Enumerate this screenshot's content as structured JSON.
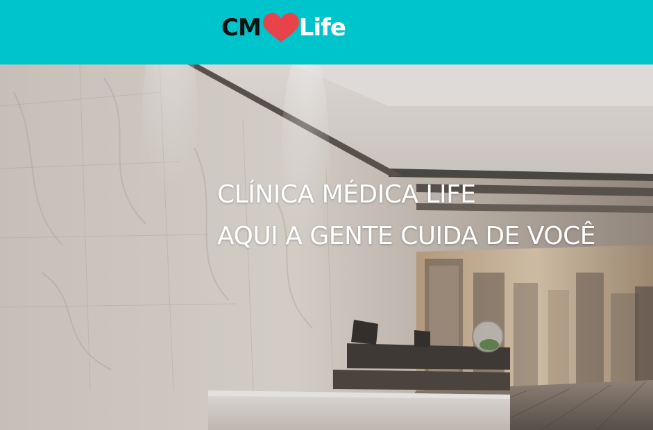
{
  "header": {
    "logo": {
      "prefix": "CM",
      "icon": "heart-icon",
      "suffix": "Life",
      "accent_color": "#e8434a"
    },
    "background_color": "#00c4cc"
  },
  "hero": {
    "line1": "CLÍNICA MÉDICA LIFE",
    "line2": "AQUI A GENTE CUIDA DE VOCÊ",
    "image": "clinic-reception-photo"
  }
}
